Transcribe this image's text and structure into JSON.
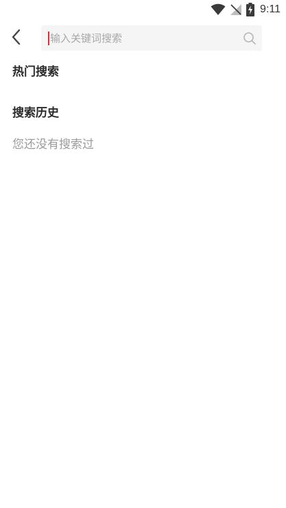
{
  "status_bar": {
    "time": "9:11",
    "icons": [
      "wifi-icon",
      "no-signal-icon",
      "battery-charging-icon"
    ]
  },
  "header": {
    "back_icon": "chevron-left-icon",
    "search": {
      "value": "",
      "placeholder": "输入关键词搜索",
      "icon": "search-icon"
    }
  },
  "sections": {
    "hot_search": {
      "title": "热门搜索"
    },
    "history": {
      "title": "搜索历史",
      "empty_text": "您还没有搜索过"
    }
  },
  "colors": {
    "accent_caret": "#e02a3e",
    "search_bg": "#f5f5f5",
    "muted_text": "#9b9b9b"
  }
}
